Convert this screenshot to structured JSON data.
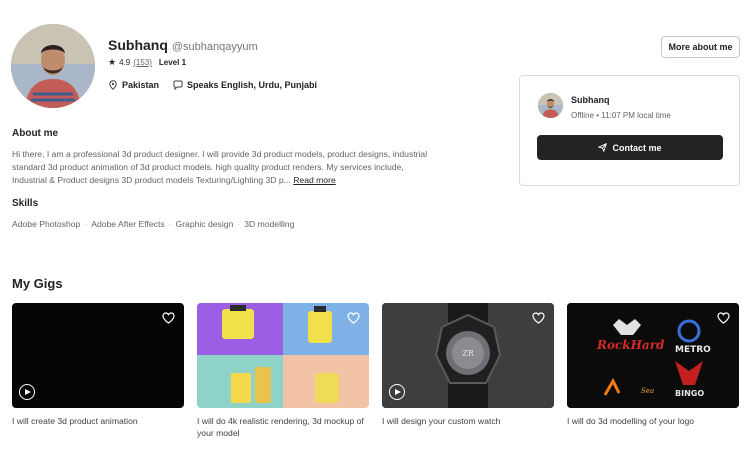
{
  "profile": {
    "name": "Subhanq",
    "handle": "@subhanqayyum",
    "rating": "4.9",
    "rating_count": "(153)",
    "level": "Level 1",
    "location": "Pakistan",
    "languages": "Speaks English, Urdu, Punjabi"
  },
  "header": {
    "more_about_me": "More about me"
  },
  "contact_card": {
    "name": "Subhanq",
    "status": "Offline • 11:07 PM local time",
    "button_label": "Contact me"
  },
  "about": {
    "title": "About me",
    "text": "Hi there, I am a professional 3d product designer. I will provide 3d product models, product designs, industrial standard 3d product animation of 3d product models. high quality product renders. My services include, Industrial & Product designs 3D product models Texturing/Lighting 3D p...",
    "read_more": "Read more"
  },
  "skills": {
    "title": "Skills",
    "items": [
      "Adobe Photoshop",
      "Adobe After Effects",
      "Graphic design",
      "3D modelling"
    ]
  },
  "gigs": {
    "title": "My Gigs",
    "items": [
      {
        "title": "I will create 3d product animation",
        "has_video": true
      },
      {
        "title": "I will do 4k realistic rendering, 3d mockup of your model",
        "has_video": false
      },
      {
        "title": "I will design your custom watch",
        "has_video": true
      },
      {
        "title": "I will do 3d modelling of your logo",
        "has_video": false
      }
    ]
  },
  "colors": {
    "text_dark": "#222325",
    "text_muted": "#62646a",
    "button_dark": "#222325",
    "border": "#dadbdd"
  }
}
